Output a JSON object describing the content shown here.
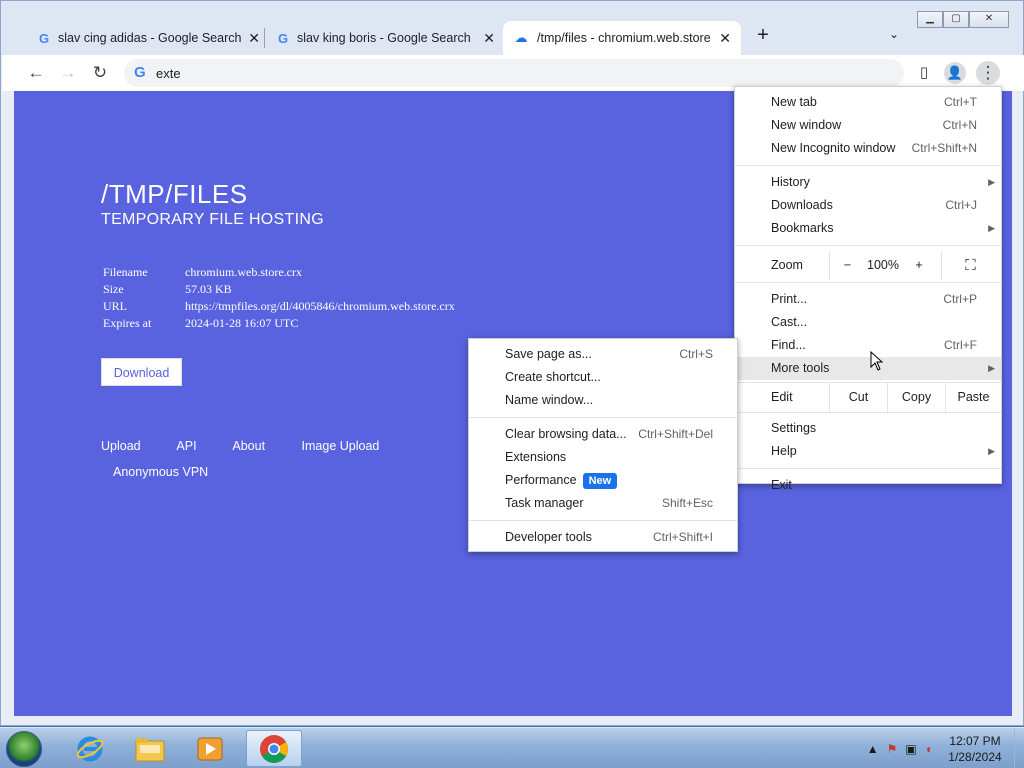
{
  "tabs": [
    {
      "title": "slav cing adidas - Google Search",
      "favicon": "G"
    },
    {
      "title": "slav king boris - Google Search",
      "favicon": "G"
    },
    {
      "title": "/tmp/files - chromium.web.store",
      "favicon": "☁"
    }
  ],
  "icons": {
    "close": "✕",
    "new_tab": "+",
    "tab_search": "⌄",
    "back": "←",
    "forward": "→",
    "reload": "↻",
    "google": "G",
    "side_panel": "▯",
    "profile": "👤",
    "kebab": "⋮",
    "submenu_arrow": "▶",
    "minimize": "▁",
    "maximize": "▢",
    "fullscreen": "⛶"
  },
  "omnibox": {
    "value": "exte"
  },
  "page": {
    "title": "/TMP/FILES",
    "subtitle": "TEMPORARY FILE HOSTING",
    "info": [
      {
        "key": "Filename",
        "value": "chromium.web.store.crx"
      },
      {
        "key": "Size",
        "value": "57.03 KB"
      },
      {
        "key": "URL",
        "value": "https://tmpfiles.org/dl/4005846/chromium.web.store.crx"
      },
      {
        "key": "Expires at",
        "value": "2024-01-28 16:07 UTC"
      }
    ],
    "download_label": "Download",
    "footer_links": [
      "Upload",
      "API",
      "About",
      "Image Upload"
    ],
    "footer_vpn": "Anonymous VPN",
    "bg_color": "#5962df"
  },
  "chrome_menu": {
    "group1": [
      {
        "label": "New tab",
        "shortcut": "Ctrl+T"
      },
      {
        "label": "New window",
        "shortcut": "Ctrl+N"
      },
      {
        "label": "New Incognito window",
        "shortcut": "Ctrl+Shift+N"
      }
    ],
    "group2": [
      {
        "label": "History",
        "shortcut": ""
      },
      {
        "label": "Downloads",
        "shortcut": "Ctrl+J"
      },
      {
        "label": "Bookmarks",
        "shortcut": ""
      }
    ],
    "zoom": {
      "label": "Zoom",
      "minus": "−",
      "value": "100%",
      "plus": "+"
    },
    "group3": [
      {
        "label": "Print...",
        "shortcut": "Ctrl+P"
      },
      {
        "label": "Cast...",
        "shortcut": ""
      },
      {
        "label": "Find...",
        "shortcut": "Ctrl+F"
      },
      {
        "label": "More tools",
        "shortcut": ""
      }
    ],
    "edit": {
      "label": "Edit",
      "cut": "Cut",
      "copy": "Copy",
      "paste": "Paste"
    },
    "group4": [
      {
        "label": "Settings",
        "shortcut": ""
      },
      {
        "label": "Help",
        "shortcut": ""
      }
    ],
    "exit": "Exit"
  },
  "more_tools_menu": {
    "group1": [
      {
        "label": "Save page as...",
        "shortcut": "Ctrl+S"
      },
      {
        "label": "Create shortcut...",
        "shortcut": ""
      },
      {
        "label": "Name window...",
        "shortcut": ""
      }
    ],
    "group2": [
      {
        "label": "Clear browsing data...",
        "shortcut": "Ctrl+Shift+Del"
      },
      {
        "label": "Extensions",
        "shortcut": ""
      },
      {
        "label": "Performance",
        "shortcut": "",
        "badge": "New"
      },
      {
        "label": "Task manager",
        "shortcut": "Shift+Esc"
      }
    ],
    "developer_tools": {
      "label": "Developer tools",
      "shortcut": "Ctrl+Shift+I"
    }
  },
  "taskbar": {
    "time": "12:07 PM",
    "date": "1/28/2024"
  }
}
